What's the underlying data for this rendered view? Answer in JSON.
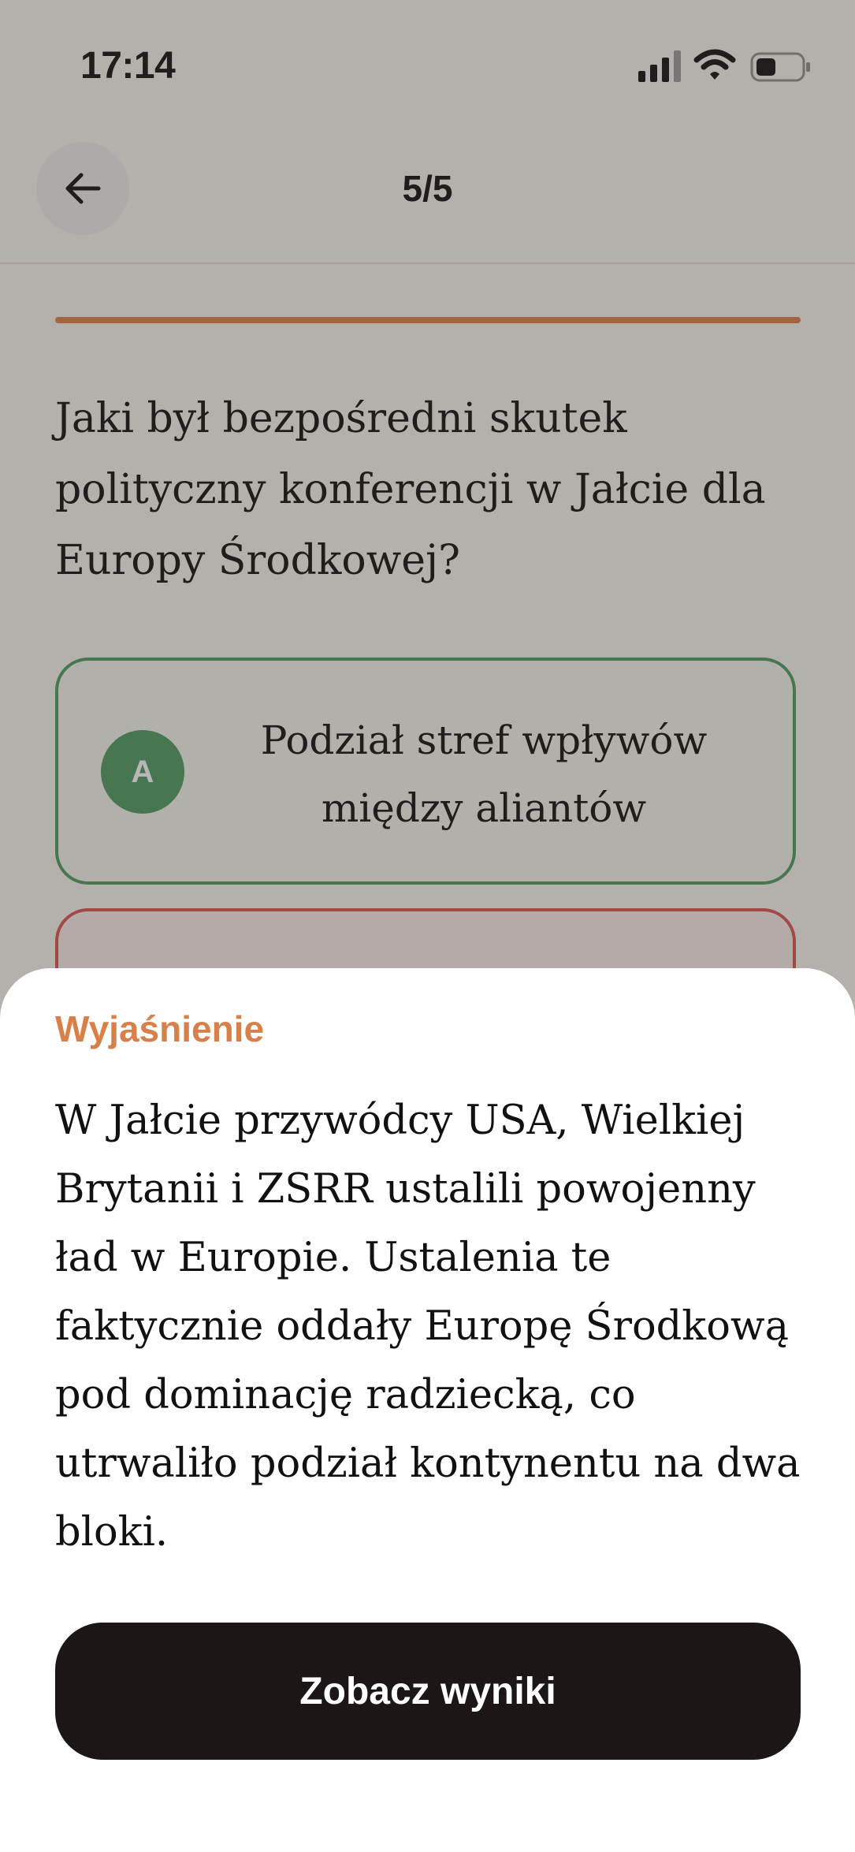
{
  "status_bar": {
    "time": "17:14",
    "icons": [
      "cellular-signal-icon",
      "wifi-icon",
      "battery-icon"
    ]
  },
  "header": {
    "back_icon": "arrow-left-icon",
    "progress": "5/5"
  },
  "quiz": {
    "progress_fraction": 1.0,
    "question": "Jaki był bezpośredni skutek polityczny konferencji w Jałcie dla Europy Środkowej?",
    "answers": [
      {
        "letter": "A",
        "text": "Podział stref wpływów między aliantów",
        "state": "correct"
      },
      {
        "letter": "",
        "text": "",
        "state": "incorrect"
      }
    ]
  },
  "explanation": {
    "title": "Wyjaśnienie",
    "body": "W Jałcie przywódcy USA, Wielkiej Brytanii i ZSRR ustalili powojenny ład w Europie. Ustalenia te faktycznie oddały Europę Środkową pod dominację radziecką, co utrwaliło podział kontynentu na dwa bloki.",
    "button_label": "Zobacz wyniki"
  },
  "colors": {
    "accent": "#d9804a",
    "correct": "#4e9a61",
    "incorrect": "#d9534f",
    "button": "#1c1716"
  }
}
